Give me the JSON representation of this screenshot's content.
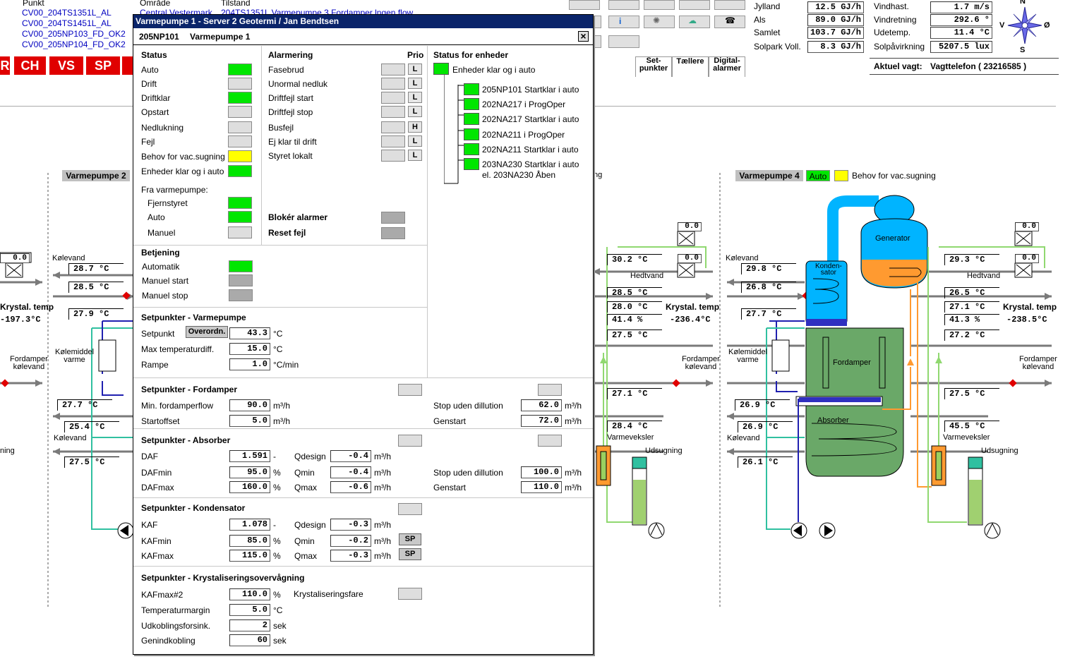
{
  "alarm_list": {
    "headers": [
      "Punkt",
      "Område",
      "Tilstand"
    ],
    "rows": [
      {
        "point": "CV00_204TS1351L_AL",
        "area": "Central Vestermark",
        "text": "204TS1351L Varmepumpe 3 Fordamper lngen flow"
      },
      {
        "point": "CV00_204TS1451L_AL",
        "area": "",
        "text": ""
      },
      {
        "point": "CV00_205NP103_FD_OK2",
        "area": "",
        "text": ""
      },
      {
        "point": "CV00_205NP104_FD_OK2",
        "area": "",
        "text": ""
      }
    ]
  },
  "nav_tabs": [
    "R",
    "CH",
    "VS",
    "SP",
    ""
  ],
  "view_tabs": [
    "Set-\npunkter",
    "Tællere",
    "Digital-\nalarmer"
  ],
  "production": [
    {
      "label": "Jylland",
      "value": "12.5 GJ/h"
    },
    {
      "label": "Als",
      "value": "89.0 GJ/h"
    },
    {
      "label": "Samlet",
      "value": "103.7 GJ/h"
    },
    {
      "label": "Solpark Voll.",
      "value": "8.3 GJ/h"
    }
  ],
  "weather": [
    {
      "label": "Vindhast.",
      "value": "1.7 m/s"
    },
    {
      "label": "Vindretning",
      "value": "292.6 °"
    },
    {
      "label": "Udetemp.",
      "value": "11.4 °C"
    },
    {
      "label": "Solpåvirkning",
      "value": "5207.5 lux"
    }
  ],
  "compass": {
    "n": "N",
    "s": "S",
    "v": "V",
    "o": "Ø"
  },
  "watch": {
    "label": "Aktuel vagt:",
    "value": "Vagttelefon ( 23216585 )"
  },
  "vp2": {
    "title": "Varmepumpe 2",
    "labels": {
      "kolevand_top": "Kølevand",
      "kolemiddel": "Kølemiddel\nvarme",
      "fordamper": "Fordamper\nkølevand",
      "kolevand_bot": "Kølevand",
      "krystal": "Krystal. temp",
      "udsugning": "ning"
    },
    "values": {
      "t1": "28.7 °C",
      "t2": "28.5 °C",
      "t3": "27.9 °C",
      "krystal": "-197.3°C",
      "t4": "27.7 °C",
      "t5": "25.4 °C",
      "t6": "27.5 °C",
      "v1": "0.0"
    }
  },
  "vp3": {
    "labels": {
      "hedtvand": "Hedtvand",
      "krystal": "Krystal. temp",
      "fordamper": "Fordamper\nkølevand",
      "varmeveksler": "Varmeveksler",
      "udsugning": "Udsugning",
      "ng": "ng"
    },
    "values": {
      "t1": "30.2 °C",
      "t2": "28.5 °C",
      "t3": "28.0 °C",
      "t4": "41.4 %",
      "t5": "27.5 °C",
      "krystal": "-236.4°C",
      "t6": "27.1 °C",
      "t7": "28.4 °C",
      "v1": "0.0",
      "v2": "0.0"
    }
  },
  "vp4": {
    "title": "Varmepumpe 4",
    "auto": "Auto",
    "behov": "Behov for vac.sugning",
    "labels": {
      "kolevand_top": "Kølevand",
      "kolemiddel": "Kølemiddel\nvarme",
      "generator": "Generator",
      "kondensator": "Konden-\nsator",
      "hedtvand": "Hedtvand",
      "fordamper_tank": "Fordamper",
      "absorber": "Absorber",
      "krystal": "Krystal. temp",
      "fordamper": "Fordamper\nkølevand",
      "kolevand_bot": "Kølevand",
      "varmeveksler": "Varmeveksler",
      "udsugning": "Udsugning"
    },
    "values": {
      "t1": "29.8 °C",
      "t2": "26.8 °C",
      "t3": "27.7 °C",
      "t4": "26.9 °C",
      "t5": "26.9 °C",
      "t6": "26.1 °C",
      "h1": "29.3 °C",
      "h2": "26.5 °C",
      "h3": "27.1 °C",
      "h4": "41.3 %",
      "h5": "27.2 °C",
      "krystal": "-238.5°C",
      "h6": "27.5 °C",
      "h7": "45.5 °C",
      "v1": "0.0",
      "v2": "0.0"
    }
  },
  "colors": {
    "alarm_red": "#e00000",
    "status_green": "#00e600",
    "status_yellow": "#ffff00",
    "titlebar": "#0a246a",
    "pipe_cyan": "#00b4ff",
    "tank_green": "#6aa868",
    "orange": "#ff9a30"
  },
  "dialog": {
    "title": "Varmepumpe 1 - Server 2 Geotermi  /  Jan Bendtsen",
    "id": "205NP101",
    "name": "Varmepumpe 1",
    "close": "×",
    "status": {
      "heading": "Status",
      "items": [
        {
          "label": "Auto",
          "state": "green"
        },
        {
          "label": "Drift",
          "state": "grey"
        },
        {
          "label": "Driftklar",
          "state": "green"
        },
        {
          "label": "Opstart",
          "state": "grey"
        },
        {
          "label": "Nedlukning",
          "state": "grey"
        },
        {
          "label": "Fejl",
          "state": "grey"
        },
        {
          "label": "Behov for vac.sugning",
          "state": "yellow"
        },
        {
          "label": "Enheder klar og i auto",
          "state": "green"
        }
      ],
      "from_heading": "Fra varmepumpe:",
      "from_items": [
        {
          "label": "Fjernstyret",
          "state": "green"
        },
        {
          "label": "Auto",
          "state": "green"
        },
        {
          "label": "Manuel",
          "state": "grey"
        }
      ]
    },
    "alarm": {
      "heading": "Alarmering",
      "prio_heading": "Prio",
      "items": [
        {
          "label": "Fasebrud",
          "prio": "L"
        },
        {
          "label": "Unormal nedluk",
          "prio": "L"
        },
        {
          "label": "Driftfejl start",
          "prio": "L"
        },
        {
          "label": "Driftfejl stop",
          "prio": "L"
        },
        {
          "label": "Busfejl",
          "prio": "H"
        },
        {
          "label": "Ej klar til drift",
          "prio": "L"
        },
        {
          "label": "Styret lokalt",
          "prio": "L"
        }
      ],
      "block": "Blokér alarmer",
      "reset": "Reset fejl"
    },
    "units_status": {
      "heading": "Status for enheder",
      "root": "Enheder klar og i auto",
      "items": [
        "205NP101 Startklar i auto",
        "202NA217 i ProgOper",
        "202NA217 Startklar i auto",
        "202NA211 i ProgOper",
        "202NA211 Startklar i auto",
        "203NA230 Startklar i auto\nel. 203NA230 Åben"
      ]
    },
    "operation": {
      "heading": "Betjening",
      "items": [
        {
          "label": "Automatik",
          "state": "green"
        },
        {
          "label": "Manuel start",
          "state": "dgrey"
        },
        {
          "label": "Manuel stop",
          "state": "dgrey"
        }
      ]
    },
    "sp_vp": {
      "heading": "Setpunkter - Varmepumpe",
      "overordn": "Overordn.",
      "rows": [
        {
          "label": "Setpunkt",
          "value": "43.3",
          "unit": "°C"
        },
        {
          "label": "Max temperaturdiff.",
          "value": "15.0",
          "unit": "°C"
        },
        {
          "label": "Rampe",
          "value": "1.0",
          "unit": "°C/min"
        }
      ]
    },
    "sp_ford": {
      "heading": "Setpunkter - Fordamper",
      "left": [
        {
          "label": "Min. fordamperflow",
          "value": "90.0",
          "unit": "m³/h"
        },
        {
          "label": "Startoffset",
          "value": "5.0",
          "unit": "m³/h"
        }
      ],
      "right": [
        {
          "label": "Stop uden dillution",
          "value": "62.0",
          "unit": "m³/h"
        },
        {
          "label": "Genstart",
          "value": "72.0",
          "unit": "m³/h"
        }
      ]
    },
    "sp_abs": {
      "heading": "Setpunkter - Absorber",
      "left": [
        {
          "label": "DAF",
          "value": "1.591",
          "unit": "-"
        },
        {
          "label": "DAFmin",
          "value": "95.0",
          "unit": "%"
        },
        {
          "label": "DAFmax",
          "value": "160.0",
          "unit": "%"
        }
      ],
      "mid": [
        {
          "label": "Qdesign",
          "value": "-0.4",
          "unit": "m³/h"
        },
        {
          "label": "Qmin",
          "value": "-0.4",
          "unit": "m³/h"
        },
        {
          "label": "Qmax",
          "value": "-0.6",
          "unit": "m³/h"
        }
      ],
      "right": [
        {
          "label": "Stop uden dillution",
          "value": "100.0",
          "unit": "m³/h"
        },
        {
          "label": "Genstart",
          "value": "110.0",
          "unit": "m³/h"
        }
      ]
    },
    "sp_kond": {
      "heading": "Setpunkter - Kondensator",
      "left": [
        {
          "label": "KAF",
          "value": "1.078",
          "unit": "-"
        },
        {
          "label": "KAFmin",
          "value": "85.0",
          "unit": "%"
        },
        {
          "label": "KAFmax",
          "value": "115.0",
          "unit": "%"
        }
      ],
      "mid": [
        {
          "label": "Qdesign",
          "value": "-0.3",
          "unit": "m³/h"
        },
        {
          "label": "Qmin",
          "value": "-0.2",
          "unit": "m³/h"
        },
        {
          "label": "Qmax",
          "value": "-0.3",
          "unit": "m³/h"
        }
      ],
      "sp": "SP"
    },
    "sp_kryst": {
      "heading": "Setpunkter - Krystaliseringsovervågning",
      "rows": [
        {
          "label": "KAFmax#2",
          "value": "110.0",
          "unit": "%"
        },
        {
          "label": "Temperaturmargin",
          "value": "5.0",
          "unit": "°C"
        },
        {
          "label": "Udkoblingsforsink.",
          "value": "2",
          "unit": "sek"
        },
        {
          "label": "Genindkobling",
          "value": "60",
          "unit": "sek"
        }
      ],
      "fare": "Krystaliseringsfare"
    }
  }
}
